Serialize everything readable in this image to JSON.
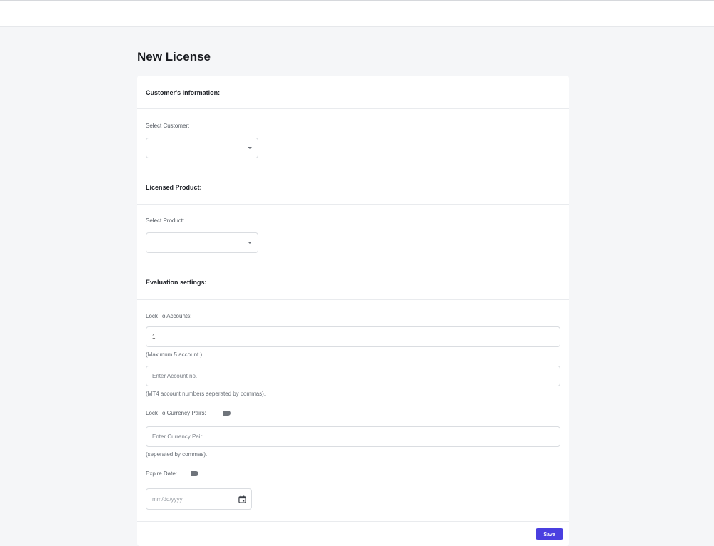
{
  "page": {
    "title": "New License"
  },
  "customer_section": {
    "title": "Customer's Information:",
    "select_label": "Select Customer:",
    "selected_value": ""
  },
  "product_section": {
    "title": "Licensed Product:",
    "select_label": "Select Product:",
    "selected_value": ""
  },
  "evaluation_section": {
    "title": "Evaluation settings:",
    "lock_accounts_label": "Lock To Accounts:",
    "lock_accounts_value": "1",
    "lock_accounts_help": "(Maximum 5 account ).",
    "account_no_placeholder": "Enter Account no.",
    "account_no_help": "(MT4 account numbers seperated by commas).",
    "currency_pairs_label": "Lock To Currency Pairs:",
    "currency_pair_placeholder": "Enter Currency Pair.",
    "currency_pair_help": "(seperated by commas).",
    "expire_date_label": "Expire Date:",
    "expire_date_placeholder": "mm/dd/yyyy"
  },
  "actions": {
    "save_label": "Save"
  },
  "colors": {
    "accent": "#4a3fe0",
    "background": "#f5f6f8",
    "card": "#ffffff"
  },
  "icons": {
    "select_caret": "chevron-down-icon",
    "date_picker": "calendar-icon",
    "toggle": "toggle-icon"
  }
}
